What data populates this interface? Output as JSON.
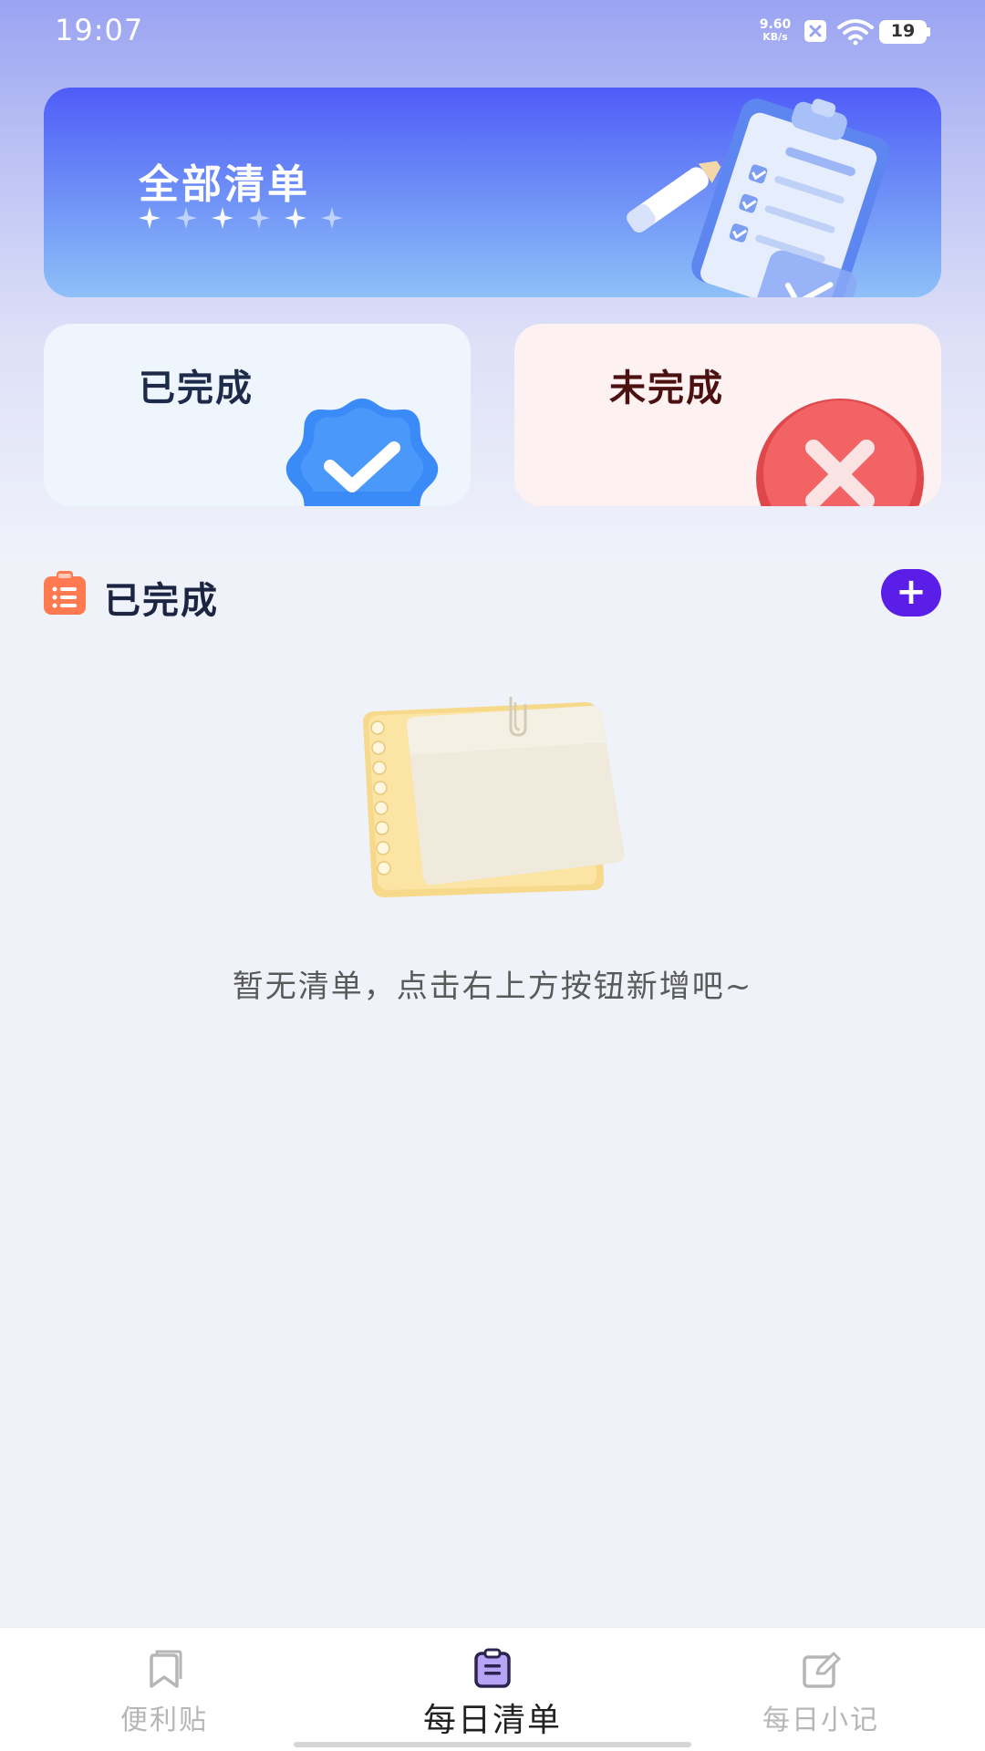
{
  "status_bar": {
    "time": "19:07",
    "net_speed_value": "9.60",
    "net_speed_unit": "KB/s",
    "battery": "19"
  },
  "banner": {
    "title": "全部清单"
  },
  "cards": {
    "done_label": "已完成",
    "todo_label": "未完成"
  },
  "section": {
    "title": "已完成",
    "add_label": "+"
  },
  "empty_state": {
    "message": "暂无清单，点击右上方按钮新增吧~"
  },
  "bottom_nav": {
    "items": [
      {
        "label": "便利贴",
        "icon": "bookmark-icon",
        "active": false
      },
      {
        "label": "每日清单",
        "icon": "clipboard-icon",
        "active": true
      },
      {
        "label": "每日小记",
        "icon": "edit-icon",
        "active": false
      }
    ]
  },
  "colors": {
    "accent": "#5b1ee8",
    "banner_start": "#4f5cf8",
    "banner_end": "#8ec0f8",
    "done_card": "#eef5fd",
    "todo_card": "#fdf1f2",
    "section_icon": "#ff7a50",
    "nav_active_icon": "#b8a4f5"
  }
}
